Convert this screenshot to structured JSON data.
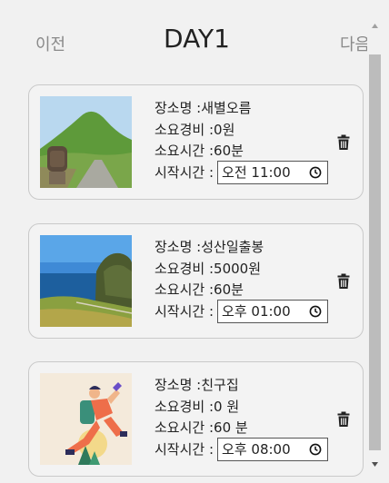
{
  "header": {
    "prev_label": "이전",
    "title": "DAY1",
    "next_label": "다음"
  },
  "labels": {
    "place": "장소명 : ",
    "cost": "소요경비 : ",
    "duration": "소요시간 : ",
    "start": "시작시간 : "
  },
  "items": [
    {
      "place": "새별오름",
      "cost": "0원",
      "duration": "60분",
      "start_time": "오전 11:00",
      "image_icon": "oreum-landscape-photo"
    },
    {
      "place": "성산일출봉",
      "cost": "5000원",
      "duration": "60분",
      "start_time": "오후 01:00",
      "image_icon": "seongsan-coast-photo"
    },
    {
      "place": "친구집",
      "cost": "0 원",
      "duration": "60 분",
      "start_time": "오후 08:00",
      "image_icon": "hiker-illustration"
    }
  ],
  "colors": {
    "background": "#f1f1f1",
    "card_border": "#c9c9c9",
    "nav_text": "#8a8a8a",
    "scroll_thumb": "#bcbcbc"
  }
}
